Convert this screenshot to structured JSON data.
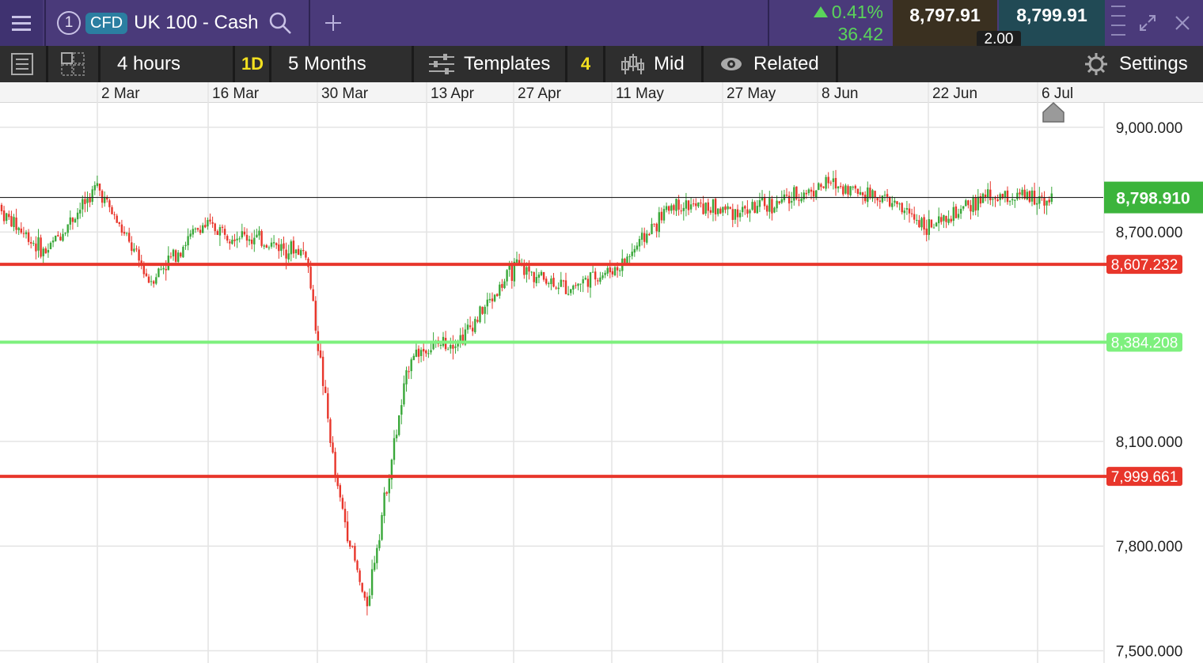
{
  "header": {
    "menu_icon": "hamburger-icon",
    "instrument_number": "1",
    "cfd_badge": "CFD",
    "instrument_name": "UK 100 - Cash",
    "search_icon": "search-icon",
    "add_icon": "plus-icon",
    "change_percent": "0.41%",
    "change_points": "36.42",
    "sell_price": "8,797.91",
    "buy_price": "8,799.91",
    "spread": "2.00",
    "colors": {
      "bar": "#4a3a7a",
      "up": "#5ad45a",
      "sell_bg": "#3a3020",
      "buy_bg": "#214a55"
    }
  },
  "toolbar": {
    "interval": "4 hours",
    "period_badge": "1D",
    "period": "5 Months",
    "templates": "Templates",
    "indicators_count": "4",
    "price_type": "Mid",
    "related": "Related",
    "settings": "Settings"
  },
  "chart_data": {
    "type": "candlestick",
    "instrument": "UK 100 - Cash",
    "x_tick_labels": [
      "2 Mar",
      "16 Mar",
      "30 Mar",
      "13 Apr",
      "27 Apr",
      "11 May",
      "27 May",
      "8 Jun",
      "22 Jun",
      "6 Jul"
    ],
    "y_tick_labels": [
      "9,000.000",
      "8,700.000",
      "8,100.000",
      "7,800.000",
      "7,500.000"
    ],
    "ylim": [
      7465,
      9070
    ],
    "grid": true,
    "x": [
      "2026-02-16",
      "2026-02-23",
      "2026-03-02",
      "2026-03-09",
      "2026-03-16",
      "2026-03-23",
      "2026-03-30",
      "2026-04-03",
      "2026-04-07",
      "2026-04-10",
      "2026-04-13",
      "2026-04-20",
      "2026-04-27",
      "2026-05-04",
      "2026-05-11",
      "2026-05-18",
      "2026-05-27",
      "2026-06-01",
      "2026-06-08",
      "2026-06-15",
      "2026-06-22",
      "2026-06-29",
      "2026-07-06"
    ],
    "close": [
      8780,
      8640,
      8830,
      8560,
      8720,
      8680,
      8640,
      7980,
      7620,
      8000,
      8350,
      8400,
      8600,
      8540,
      8600,
      8780,
      8760,
      8780,
      8840,
      8800,
      8710,
      8800,
      8799
    ],
    "current_price": "8,798.910",
    "horizontal_lines": [
      {
        "label": "8,607.232",
        "value": 8607.232,
        "color": "#e8362b"
      },
      {
        "label": "8,384.208",
        "value": 8384.208,
        "color": "#7ef07e"
      },
      {
        "label": "7,999.661",
        "value": 7999.661,
        "color": "#e8362b"
      }
    ],
    "colors": {
      "up": "#3aa83a",
      "down": "#e8362b",
      "current": "#3cb43c"
    }
  }
}
